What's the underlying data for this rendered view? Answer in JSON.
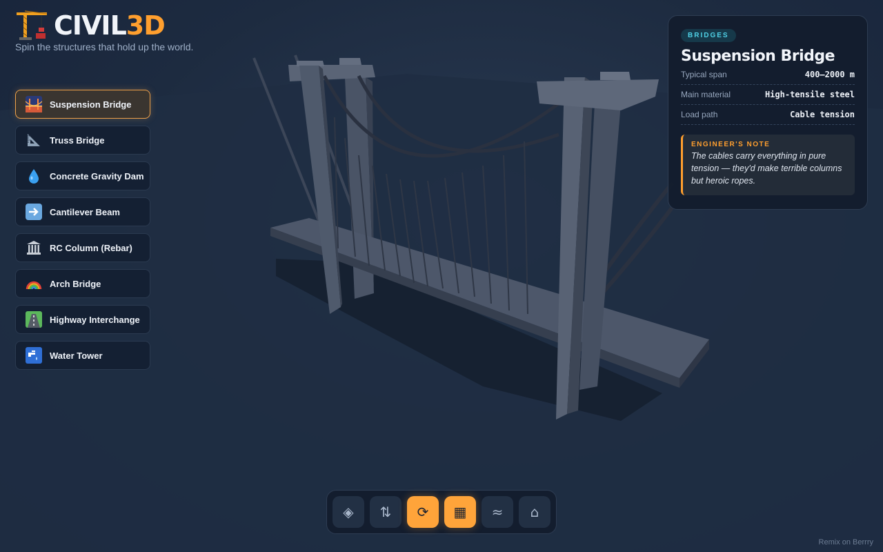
{
  "brand": {
    "title_main": "CIVIL",
    "title_accent": "3D",
    "tagline": "Spin the structures that hold up the world."
  },
  "structures": [
    {
      "label": "Suspension Bridge",
      "icon": "bridge-at-night-icon",
      "active": true
    },
    {
      "label": "Truss Bridge",
      "icon": "triangular-ruler-icon",
      "active": false
    },
    {
      "label": "Concrete Gravity Dam",
      "icon": "droplet-icon",
      "active": false
    },
    {
      "label": "Cantilever Beam",
      "icon": "right-arrow-icon",
      "active": false
    },
    {
      "label": "RC Column (Rebar)",
      "icon": "classical-building-icon",
      "active": false
    },
    {
      "label": "Arch Bridge",
      "icon": "rainbow-icon",
      "active": false
    },
    {
      "label": "Highway Interchange",
      "icon": "motorway-icon",
      "active": false
    },
    {
      "label": "Water Tower",
      "icon": "water-tap-icon",
      "active": false
    }
  ],
  "info": {
    "category": "BRIDGES",
    "title": "Suspension Bridge",
    "specs": [
      {
        "key": "Typical span",
        "value": "400–2000 m"
      },
      {
        "key": "Main material",
        "value": "High-tensile steel"
      },
      {
        "key": "Load path",
        "value": "Cable tension"
      }
    ],
    "note_heading": "ENGINEER'S NOTE",
    "note_body": "The cables carry everything in pure tension — they'd make terrible columns but heroic ropes."
  },
  "toolbar": [
    {
      "glyph": "◈",
      "icon": "layers-icon",
      "on": false
    },
    {
      "glyph": "⇅",
      "icon": "up-down-arrows-icon",
      "on": false
    },
    {
      "glyph": "⟳",
      "icon": "auto-rotate-icon",
      "on": true
    },
    {
      "glyph": "▦",
      "icon": "grid-icon",
      "on": true
    },
    {
      "glyph": "≈",
      "icon": "water-waves-icon",
      "on": false
    },
    {
      "glyph": "⌂",
      "icon": "home-icon",
      "on": false
    }
  ],
  "footer": {
    "remix": "Remix on Berrry"
  },
  "colors": {
    "accent": "#ff9f2e",
    "badge": "#4fd1e6",
    "background": "#1d2b40"
  }
}
